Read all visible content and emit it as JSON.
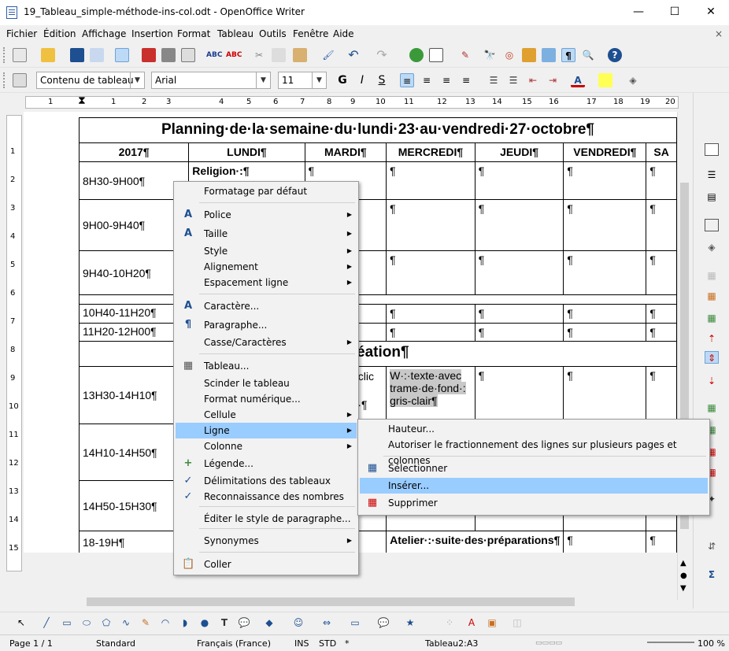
{
  "window": {
    "title": "19_Tableau_simple-méthode-ins-col.odt - OpenOffice Writer",
    "minimize": "—",
    "maximize": "☐",
    "close": "✕"
  },
  "menubar": {
    "items": [
      "Fichier",
      "Édition",
      "Affichage",
      "Insertion",
      "Format",
      "Tableau",
      "Outils",
      "Fenêtre",
      "Aide"
    ],
    "close": "×"
  },
  "formatting": {
    "style": "Contenu de tableau",
    "font": "Arial",
    "size": "11"
  },
  "ruler": {
    "marks": [
      "1",
      "1",
      "2",
      "3",
      "4",
      "5",
      "6",
      "7",
      "8",
      "9",
      "10",
      "11",
      "12",
      "13",
      "14",
      "15",
      "16",
      "17",
      "18",
      "19",
      "20"
    ],
    "vmarks": [
      "1",
      "2",
      "3",
      "4",
      "5",
      "6",
      "7",
      "8",
      "9",
      "10",
      "11",
      "12",
      "13",
      "14",
      "15"
    ]
  },
  "table": {
    "title": "Planning·de·la·semaine·du·lundi·23·au·vendredi·27·octobre¶",
    "headers": [
      "2017¶",
      "LUNDI¶",
      "MARDI¶",
      "MERCREDI¶",
      "JEUDI¶",
      "VENDREDI¶",
      "SA"
    ],
    "rows": [
      {
        "time": "8H30-9H00¶",
        "lundi": "Religion·:¶",
        "mardi": "¶",
        "mercredi": "¶",
        "jeudi": "¶",
        "vendredi": "¶",
        "sa": "¶"
      },
      {
        "time": "9H00-9H40¶",
        "mercredi": "¶",
        "jeudi": "¶",
        "vendredi": "¶",
        "sa": "¶"
      },
      {
        "time": "9H40-10H20¶",
        "mercredi": "¶",
        "jeudi": "¶",
        "vendredi": "¶",
        "sa": "¶"
      },
      {
        "time": "10H40-11H20¶",
        "mercredi": "¶",
        "jeudi": "¶",
        "vendredi": "¶",
        "sa": "¶"
      },
      {
        "time": "11H20-12H00¶",
        "mercredi": "¶",
        "jeudi": "¶",
        "vendredi": "¶",
        "sa": "¶"
      },
      {
        "merged": "éation¶"
      },
      {
        "time": "13H30-14H10¶",
        "mardi_a": "·/·clic",
        "mardi_b": "re·/·",
        "mardi_c": "·:·gris·¶",
        "mercredi_a": "W·:·texte·avec",
        "mercredi_b": "trame·de·fond·:",
        "mercredi_c": "gris-clair¶",
        "jeudi": "¶",
        "vendredi": "¶",
        "sa": "¶"
      },
      {
        "time": "14H10-14H50¶"
      },
      {
        "time": "14H50-15H30¶"
      },
      {
        "time": "18-19H¶",
        "mercredi": "Atelier·:·suite·des·préparations¶",
        "vendredi": "¶",
        "sa": "¶"
      }
    ]
  },
  "context_menu": {
    "items": [
      {
        "label": "Formatage par défaut"
      },
      {
        "label": "Police",
        "icon": "A",
        "sub": "▶"
      },
      {
        "label": "Taille",
        "icon": "A",
        "sub": "▶"
      },
      {
        "label": "Style",
        "sub": "▶"
      },
      {
        "label": "Alignement",
        "sub": "▶"
      },
      {
        "label": "Espacement ligne",
        "sub": "▶"
      },
      {
        "label": "Caractère...",
        "icon": "A"
      },
      {
        "label": "Paragraphe...",
        "icon": "¶"
      },
      {
        "label": "Casse/Caractères",
        "sub": "▶"
      },
      {
        "label": "Tableau...",
        "icon": "▦"
      },
      {
        "label": "Scinder le tableau"
      },
      {
        "label": "Format numérique..."
      },
      {
        "label": "Cellule",
        "sub": "▶"
      },
      {
        "label": "Ligne",
        "sub": "▶"
      },
      {
        "label": "Colonne",
        "sub": "▶"
      },
      {
        "label": "Légende...",
        "icon": "+"
      },
      {
        "label": "Délimitations des tableaux",
        "icon": "✓"
      },
      {
        "label": "Reconnaissance des nombres",
        "icon": "✓"
      },
      {
        "label": "Éditer le style de paragraphe..."
      },
      {
        "label": "Synonymes",
        "sub": "▶"
      },
      {
        "label": "Coller",
        "icon": "📋"
      }
    ]
  },
  "submenu": {
    "items": [
      {
        "label": "Hauteur..."
      },
      {
        "label": "Autoriser le fractionnement des lignes sur plusieurs pages et colonnes"
      },
      {
        "label": "Sélectionner",
        "icon": "▦"
      },
      {
        "label": "Insérer..."
      },
      {
        "label": "Supprimer",
        "icon": "▦"
      }
    ]
  },
  "statusbar": {
    "page": "Page 1 / 1",
    "style": "Standard",
    "language": "Français (France)",
    "ins": "INS",
    "std": "STD",
    "mod": "*",
    "cell": "Tableau2:A3",
    "zoom": "100 %"
  }
}
